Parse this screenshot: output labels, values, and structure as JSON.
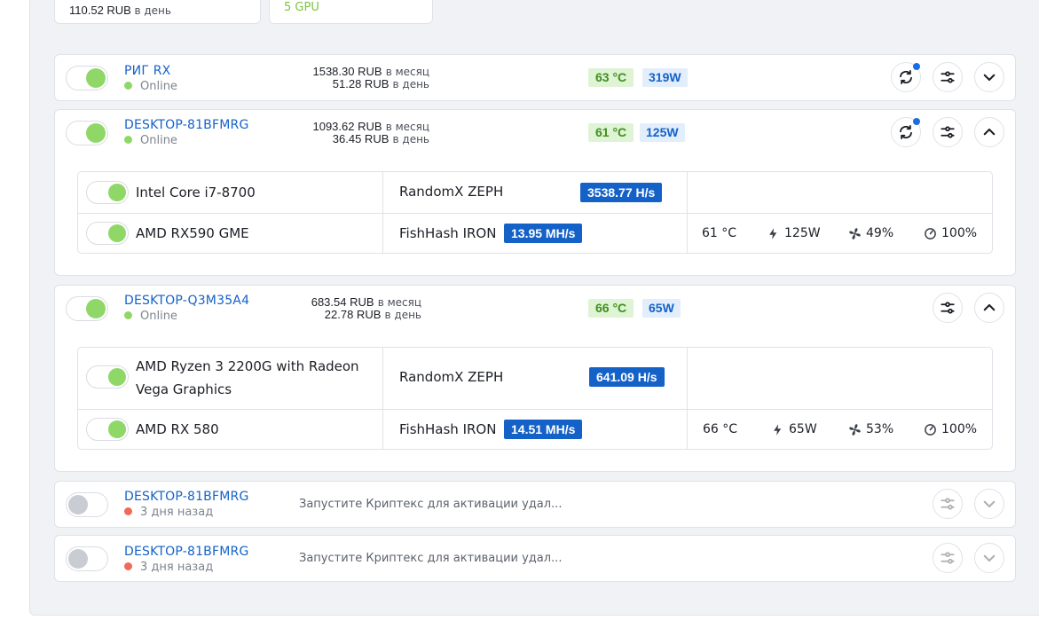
{
  "summary": {
    "earn_day_value": "110.52 RUB",
    "earn_day_unit": "в день",
    "gpu_count": "5 GPU"
  },
  "rigs": [
    {
      "name": "РИГ RX",
      "status": "Online",
      "month_value": "1538.30 RUB",
      "day_value": "51.28 RUB",
      "month_unit": "в месяц",
      "day_unit": "в день",
      "temp": "63 °C",
      "power": "319W"
    },
    {
      "name": "DESKTOP-81BFMRG",
      "status": "Online",
      "month_value": "1093.62 RUB",
      "day_value": "36.45 RUB",
      "month_unit": "в месяц",
      "day_unit": "в день",
      "temp": "61 °C",
      "power": "125W",
      "devices": [
        {
          "name": "Intel Core i7-8700",
          "algo": "RandomX ZEPH",
          "hashrate": "3538.77 H/s"
        },
        {
          "name": "AMD RX590 GME",
          "algo": "FishHash IRON",
          "hashrate": "13.95 MH/s",
          "temp": "61 °C",
          "power": "125W",
          "fan": "49%",
          "load": "100%"
        }
      ]
    },
    {
      "name": "DESKTOP-Q3M35A4",
      "status": "Online",
      "month_value": "683.54 RUB",
      "day_value": "22.78 RUB",
      "month_unit": "в месяц",
      "day_unit": "в день",
      "temp": "66 °C",
      "power": "65W",
      "devices": [
        {
          "name_line1": "AMD Ryzen 3 2200G with Radeon",
          "name_line2": "Vega Graphics",
          "algo": "RandomX ZEPH",
          "hashrate": "641.09 H/s"
        },
        {
          "name": "AMD RX 580",
          "algo": "FishHash IRON",
          "hashrate": "14.51 MH/s",
          "temp": "66 °C",
          "power": "65W",
          "fan": "53%",
          "load": "100%"
        }
      ]
    },
    {
      "name": "DESKTOP-81BFMRG",
      "status": "3 дня назад",
      "message": "Запустите Криптекс для активации удал..."
    },
    {
      "name": "DESKTOP-81BFMRG",
      "status": "3 дня назад",
      "message": "Запустите Криптекс для активации удал..."
    }
  ],
  "icons": {
    "restart": "refresh-icon",
    "settings": "sliders-icon",
    "expand": "chevron-down-icon",
    "collapse": "chevron-up-icon",
    "power": "bolt-icon",
    "fan": "fan-icon",
    "load": "gauge-icon"
  },
  "colors": {
    "accent": "#1462c8",
    "online": "#8fd868",
    "offline": "#f06a5a",
    "temp_badge_bg": "#dff3d5",
    "watt_badge_bg": "#e2eefc"
  }
}
